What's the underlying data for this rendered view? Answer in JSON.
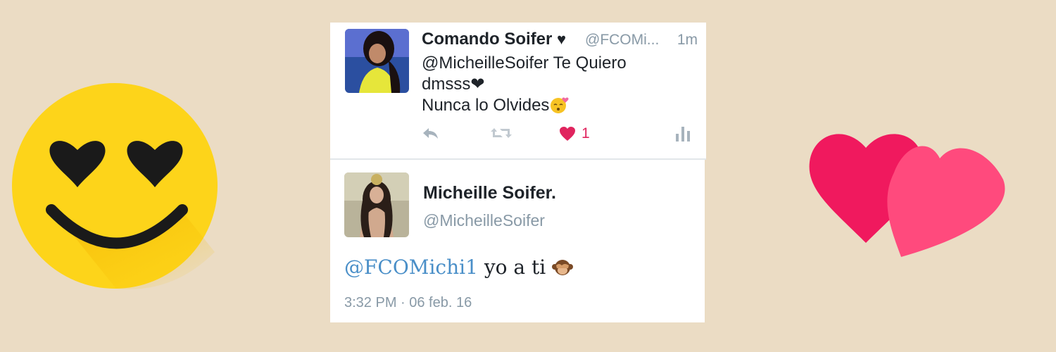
{
  "tweet1": {
    "name": "Comando Soifer",
    "name_heart": "♥",
    "handle": "@FCOMi...",
    "time": "1m",
    "body_lines": [
      "@MicheilleSoifer Te Quiero",
      "dmsss❤",
      "Nunca lo Olvides"
    ],
    "like_count": "1",
    "icons": [
      "reply-icon",
      "retweet-icon",
      "like-icon",
      "analytics-icon"
    ]
  },
  "tweet2": {
    "name": "Micheille Soifer.",
    "handle": "@MicheilleSoifer",
    "mention": "@FCOMichi1",
    "body_text": " yo a ti ",
    "timestamp": "3:32 PM · 06 feb. 16"
  },
  "colors": {
    "background": "#ebdcc4",
    "like": "#e0245e",
    "link": "#4a8fc8",
    "muted": "#8899a6"
  }
}
